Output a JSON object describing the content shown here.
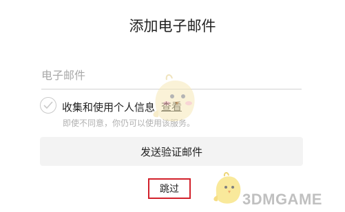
{
  "header": {
    "title": "添加电子邮件"
  },
  "email": {
    "placeholder": "电子邮件",
    "value": ""
  },
  "consent": {
    "label": "收集和使用个人信息",
    "link": "查看",
    "note": "即使不同意，你仍可以使用该服务。",
    "checked": false
  },
  "actions": {
    "send_label": "发送验证邮件",
    "skip_label": "跳过"
  },
  "watermark": {
    "text": "3DMGAME"
  },
  "colors": {
    "highlight_border": "#d2202a",
    "send_button_bg": "#f3f3f3",
    "divider": "#d2d2d2"
  },
  "icons": [
    "check-icon",
    "mascot-icon"
  ]
}
